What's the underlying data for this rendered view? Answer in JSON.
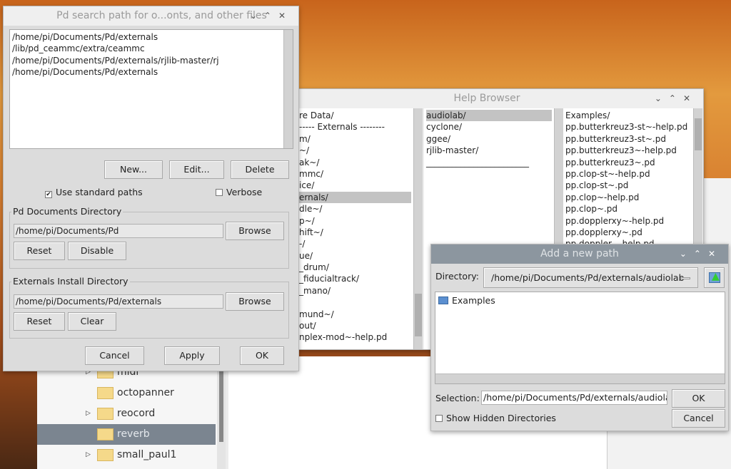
{
  "search_dialog": {
    "title": "Pd search path for o...onts, and other files",
    "paths": [
      "/home/pi/Documents/Pd/externals",
      "/lib/pd_ceammc/extra/ceammc",
      "/home/pi/Documents/Pd/externals/rjlib-master/rj",
      "/home/pi/Documents/Pd/externals"
    ],
    "new_label": "New...",
    "edit_label": "Edit...",
    "delete_label": "Delete",
    "use_standard_paths": "Use standard paths",
    "use_standard_checked": true,
    "verbose": "Verbose",
    "verbose_checked": false,
    "docs_group": "Pd Documents Directory",
    "docs_path": "/home/pi/Documents/Pd",
    "browse": "Browse",
    "reset": "Reset",
    "disable": "Disable",
    "ext_group": "Externals Install Directory",
    "ext_path": "/home/pi/Documents/Pd/externals",
    "clear": "Clear",
    "cancel": "Cancel",
    "apply": "Apply",
    "ok": "OK"
  },
  "help_browser": {
    "title": "Help Browser",
    "col1": [
      "re Data/",
      "----- Externals --------",
      "m/",
      "~/",
      "ak~/",
      "mmc/",
      "ice/",
      "ernals/",
      "dle~/",
      "p~/",
      "hift~/",
      "-/",
      "ue/",
      "_drum/",
      "_fiducialtrack/",
      "_mano/",
      "",
      "mund~/",
      "out/",
      "nplex-mod~-help.pd"
    ],
    "col1_selected": 7,
    "col2": [
      "audiolab/",
      "cyclone/",
      "ggee/",
      "rjlib-master/",
      "________________________"
    ],
    "col2_selected": 0,
    "col3": [
      "Examples/",
      "pp.butterkreuz3-st~-help.pd",
      "pp.butterkreuz3-st~.pd",
      "pp.butterkreuz3~-help.pd",
      "pp.butterkreuz3~.pd",
      "pp.clop-st~-help.pd",
      "pp.clop-st~.pd",
      "pp.clop~-help.pd",
      "pp.clop~.pd",
      "pp.dopplerxy~-help.pd",
      "pp.dopplerxy~.pd",
      "pp.doppler...-help.pd"
    ]
  },
  "add_path": {
    "title": "Add a new path",
    "directory_label": "Directory:",
    "directory_value": "/home/pi/Documents/Pd/externals/audiolab",
    "items": [
      "Examples"
    ],
    "selection_label": "Selection:",
    "selection_value": "/home/pi/Documents/Pd/externals/audiolab",
    "ok": "OK",
    "cancel": "Cancel",
    "show_hidden": "Show Hidden Directories",
    "show_hidden_checked": false
  },
  "file_manager": {
    "items": [
      {
        "name": "midi",
        "expander": true
      },
      {
        "name": "octopanner",
        "expander": false
      },
      {
        "name": "reocord",
        "expander": true
      },
      {
        "name": "reverb",
        "expander": false,
        "selected": true
      },
      {
        "name": "small_paul1",
        "expander": true
      }
    ]
  },
  "window_controls": {
    "minimize": "⌄",
    "maximize": "⌃",
    "close": "✕"
  }
}
